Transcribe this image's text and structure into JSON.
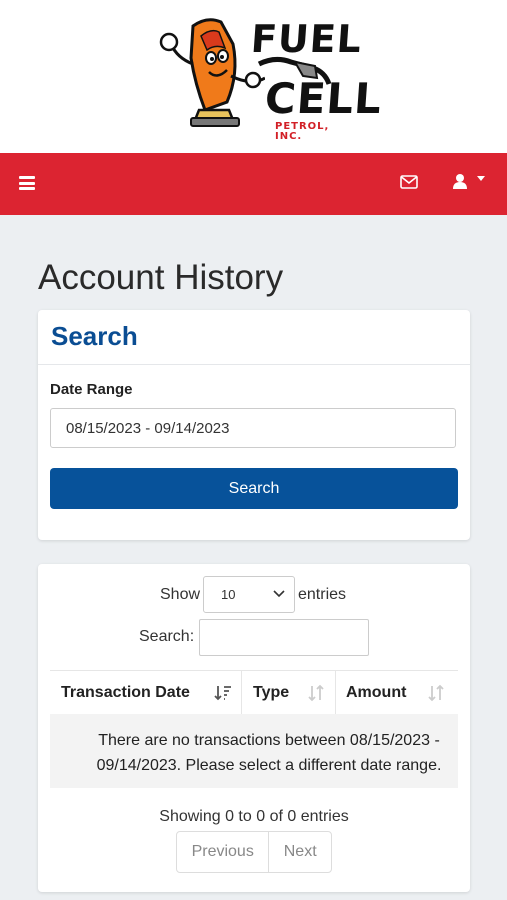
{
  "brand": {
    "word1": "FUEL",
    "word2": "CELL",
    "sub": "PETROL, INC.",
    "colors": {
      "primary_red": "#dc2431",
      "primary_blue": "#07529a",
      "logo_orange": "#f07a1a"
    }
  },
  "navbar": {
    "menu_icon": "hamburger-icon",
    "mail_icon": "envelope-icon",
    "user_icon": "user-icon",
    "dropdown_icon": "caret-down-icon"
  },
  "page": {
    "title": "Account History"
  },
  "search_card": {
    "heading": "Search",
    "date_range_label": "Date Range",
    "date_range_value": "08/15/2023 - 09/14/2023",
    "button_label": "Search"
  },
  "table_card": {
    "show_label": "Show",
    "page_size": "10",
    "entries_label": "entries",
    "search_label": "Search:",
    "search_value": "",
    "columns": [
      {
        "label": "Transaction Date"
      },
      {
        "label": "Type"
      },
      {
        "label": "Amount"
      }
    ],
    "empty_message": "There are no transactions between 08/15/2023 - 09/14/2023. Please select a different date range.",
    "showing_text": "Showing 0 to 0 of 0 entries",
    "previous_label": "Previous",
    "next_label": "Next"
  }
}
